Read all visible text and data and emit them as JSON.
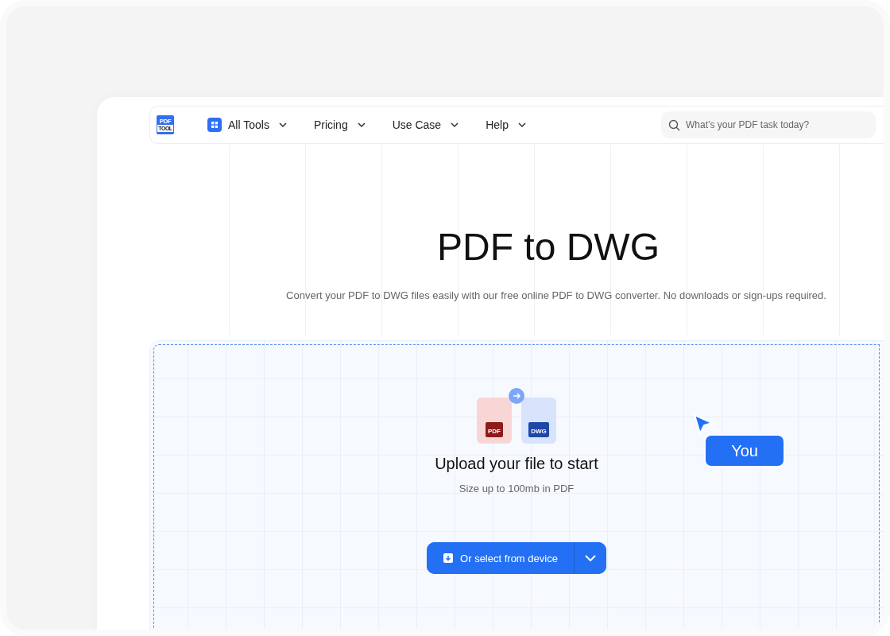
{
  "logo": {
    "top": "PDF",
    "bottom": "TOOL"
  },
  "nav": [
    {
      "label": "All Tools",
      "kind": "tools"
    },
    {
      "label": "Pricing",
      "kind": "plain"
    },
    {
      "label": "Use Case",
      "kind": "plain"
    },
    {
      "label": "Help",
      "kind": "plain"
    }
  ],
  "search": {
    "placeholder": "What’s your PDF task today?"
  },
  "hero": {
    "title": "PDF to DWG",
    "subtitle": "Convert your PDF to DWG files easily with our free online PDF to DWG converter. No downloads or sign-ups required."
  },
  "upload": {
    "from_label": "PDF",
    "to_label": "DWG",
    "heading": "Upload your file to start",
    "note": "Size up to 100mb in PDF",
    "button": "Or select from device"
  },
  "cursor": {
    "label": "You"
  }
}
